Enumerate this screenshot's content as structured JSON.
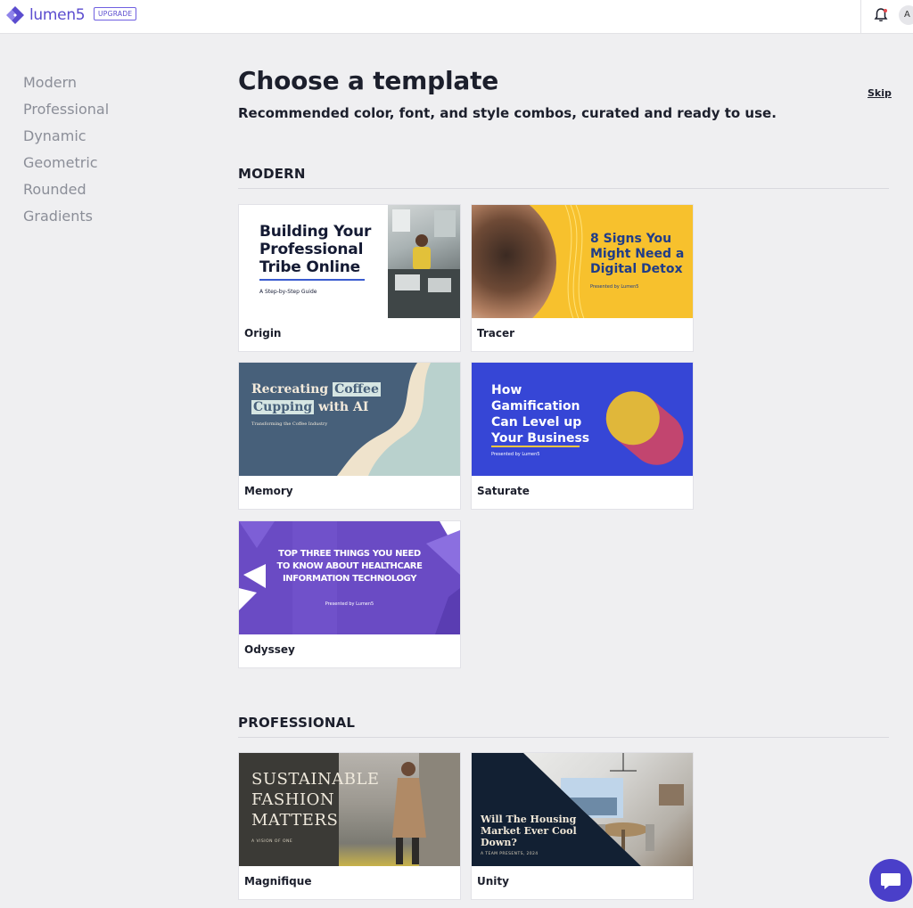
{
  "topbar": {
    "logo_text": "lumen5",
    "upgrade_label": "UPGRADE",
    "avatar_initial": "A",
    "brand_color": "#5b4ccf"
  },
  "sidebar": {
    "items": [
      {
        "label": "Modern"
      },
      {
        "label": "Professional"
      },
      {
        "label": "Dynamic"
      },
      {
        "label": "Geometric"
      },
      {
        "label": "Rounded"
      },
      {
        "label": "Gradients"
      }
    ]
  },
  "header": {
    "title": "Choose a template",
    "subtitle": "Recommended color, font, and style combos, curated and ready to use.",
    "skip_label": "Skip"
  },
  "sections": [
    {
      "heading": "MODERN",
      "templates": [
        {
          "name": "Origin",
          "preview_title": "Building Your Professional Tribe Online",
          "preview_sub": "A Step-by-Step Guide"
        },
        {
          "name": "Tracer",
          "preview_title": "8 Signs You Might Need a Digital Detox",
          "preview_sub": "Presented by Lumen5"
        },
        {
          "name": "Memory",
          "preview_title_a": "Recreating",
          "preview_title_b": "Coffee",
          "preview_title_c": "Cupping",
          "preview_title_d": "with AI",
          "preview_sub": "Transforming the Coffee Industry"
        },
        {
          "name": "Saturate",
          "preview_title": "How Gamification Can Level up Your Business",
          "preview_sub": "Presented by Lumen5"
        },
        {
          "name": "Odyssey",
          "preview_title": "TOP THREE THINGS YOU NEED TO KNOW ABOUT HEALTHCARE INFORMATION TECHNOLOGY",
          "preview_sub": "Presented by Lumen5"
        }
      ]
    },
    {
      "heading": "PROFESSIONAL",
      "templates": [
        {
          "name": "Magnifique",
          "preview_title": "SUSTAINABLE FASHION MATTERS",
          "preview_sub": "A VISION OF ONE"
        },
        {
          "name": "Unity",
          "preview_title": "Will The Housing Market Ever Cool Down?",
          "preview_sub": "A TEAM PRESENTS, 2024"
        }
      ]
    }
  ]
}
